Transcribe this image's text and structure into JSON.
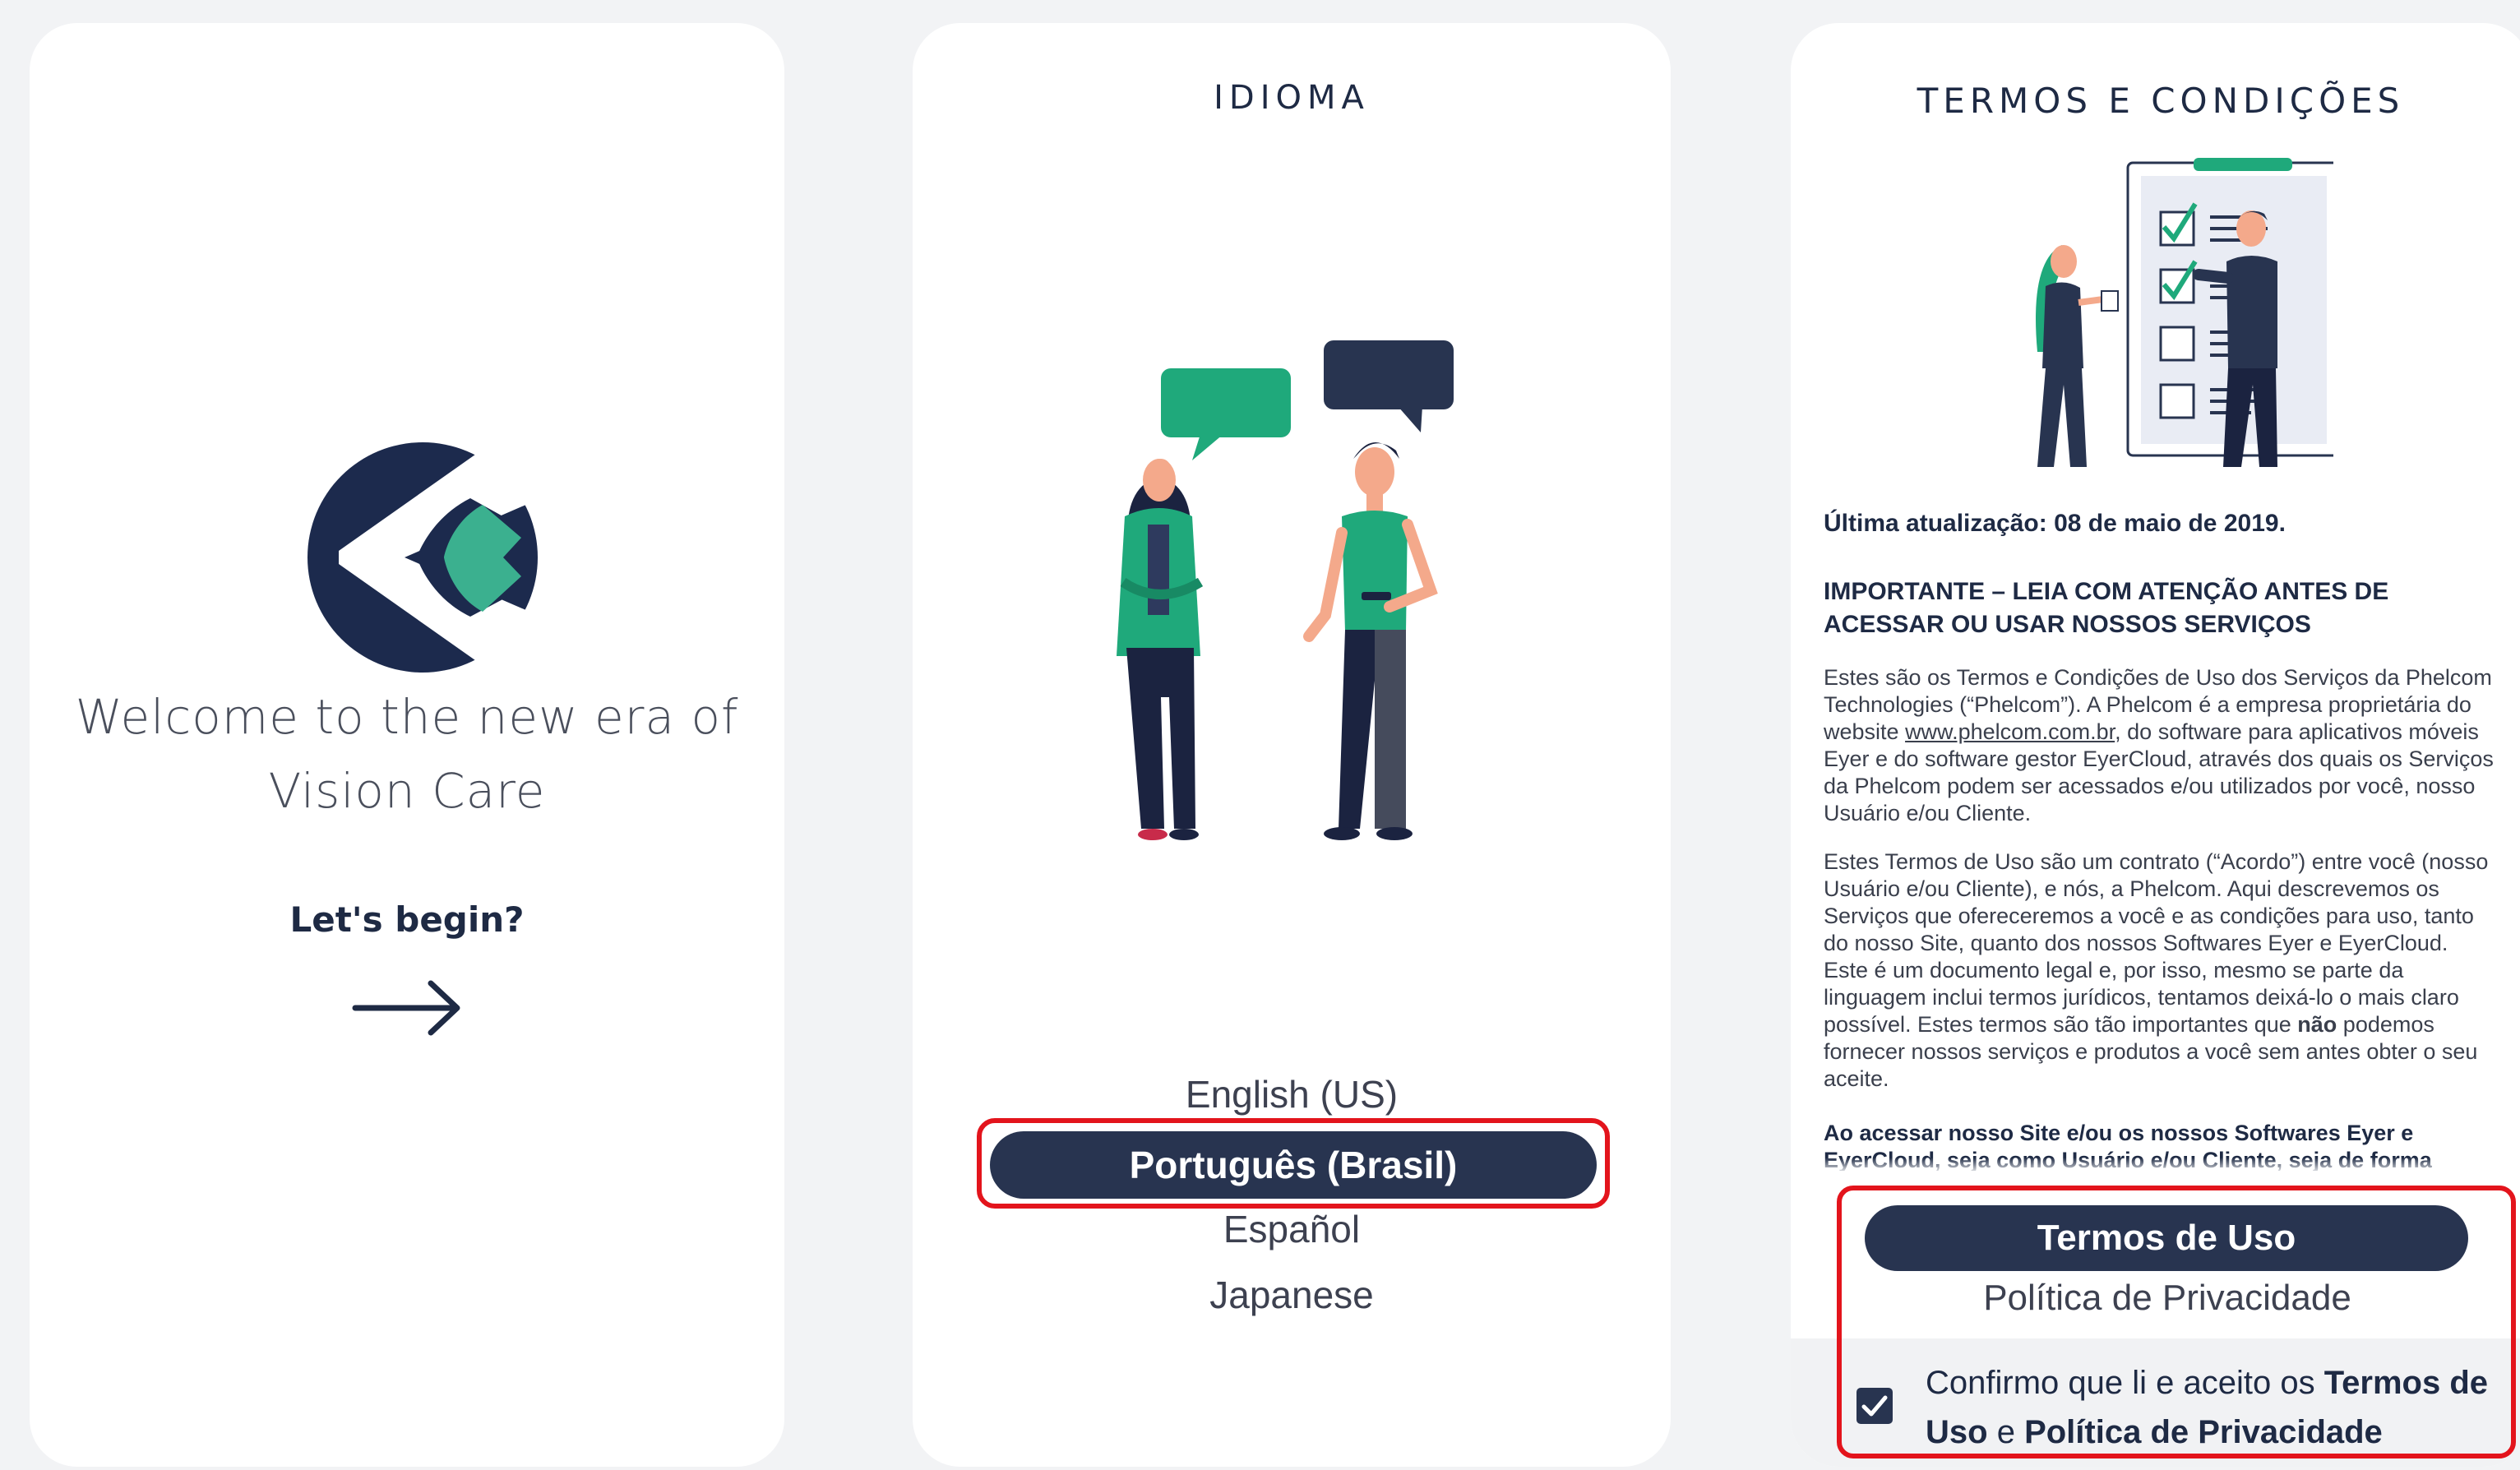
{
  "welcome_screen": {
    "welcome_line1": "Welcome to the new era of",
    "welcome_line2": "Vision Care",
    "begin_label": "Let's begin?",
    "arrow_icon": "arrow-right-icon",
    "logo_icon": "eye-care-logo"
  },
  "language_screen": {
    "title": "IDIOMA",
    "options": [
      "English (US)",
      "Português (Brasil)",
      "Español",
      "Japanese"
    ],
    "selected": "Português (Brasil)",
    "illustration": "people-talking-illustration"
  },
  "terms_screen": {
    "title": "TERMOS E CONDIÇÕES",
    "illustration": "checklist-illustration",
    "last_updated": "Última atualização: 08 de maio de 2019.",
    "important": "IMPORTANTE – LEIA COM ATENÇÃO ANTES DE ACESSAR OU USAR NOSSOS SERVIÇOS",
    "paragraph1_before_link": "Estes são os Termos e Condições de Uso dos Serviços da Phelcom Technologies (“Phelcom”). A Phelcom é a empresa proprietária do website ",
    "paragraph1_link": "www.phelcom.com.br",
    "paragraph1_after_link": ", do software para aplicativos móveis Eyer e do software gestor EyerCloud, através dos quais os Serviços da Phelcom podem ser acessados e/ou utilizados por você, nosso Usuário e/ou Cliente.",
    "paragraph2_before_bold": "Estes Termos de Uso são um contrato (“Acordo”) entre você (nosso Usuário e/ou Cliente), e nós, a Phelcom. Aqui descrevemos os Serviços que ofereceremos a você e as condições para uso, tanto do nosso Site, quanto dos nossos Softwares Eyer e EyerCloud. Este é um documento legal e, por isso, mesmo se parte da linguagem inclui termos jurídicos, tentamos deixá-lo o mais claro possível. Estes termos são tão importantes que ",
    "paragraph2_bold": "não",
    "paragraph2_after_bold": " podemos fornecer nossos serviços e produtos a você sem antes obter o seu aceite.",
    "paragraph3": "Ao acessar nosso Site e/ou os nossos Softwares Eyer e EyerCloud, seja como Usuário e/ou Cliente, seja de forma",
    "tab_terms": "Termos de Uso",
    "tab_privacy": "Política de Privacidade",
    "confirm_prefix": "Confirmo que li e aceito os ",
    "confirm_terms": "Termos de Uso",
    "confirm_and": " e ",
    "confirm_privacy": "Política de Privacidade",
    "checkbox_checked": true
  },
  "colors": {
    "navy": "#283450",
    "green": "#1fa97b",
    "highlight": "#e3141c"
  }
}
